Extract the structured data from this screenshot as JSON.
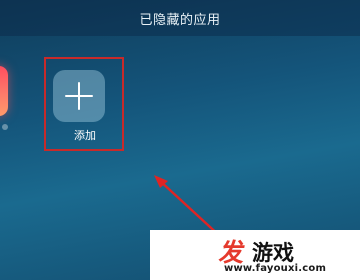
{
  "header": {
    "title": "已隐藏的应用"
  },
  "apps": [
    {
      "label": "添加",
      "icon": "plus-icon"
    }
  ],
  "watermark": {
    "brand_fa": "发",
    "brand_youxi": "游戏",
    "url": "www.fayouxi.com"
  },
  "colors": {
    "highlight_box": "#c82a2a",
    "arrow": "#e02424",
    "brand_red": "#e53a2d"
  }
}
